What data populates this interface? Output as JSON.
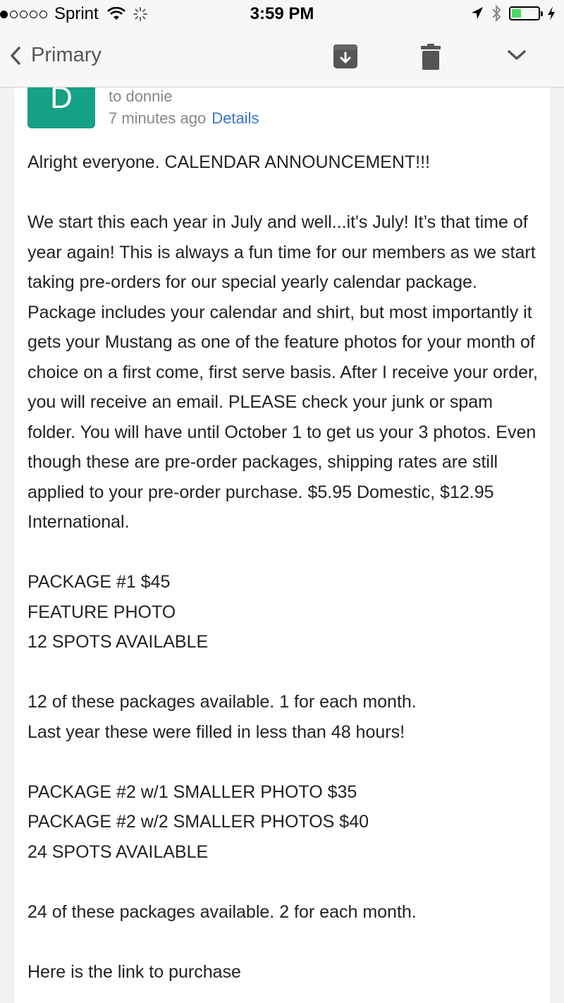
{
  "status": {
    "carrier": "Sprint",
    "time": "3:59 PM",
    "signal_dots_filled": 1,
    "signal_dots_total": 5,
    "battery_level": 0.35
  },
  "toolbar": {
    "back_label": "Primary"
  },
  "email": {
    "avatar_letter": "D",
    "to": "to donnie",
    "time_ago": "7 minutes ago",
    "details_link": "Details",
    "paragraphs": [
      [
        "Alright everyone. CALENDAR ANNOUNCEMENT!!!"
      ],
      [
        "We start this each year in July and well...it's July! It’s that time of year again! This is always a fun time for our members as we start taking pre-orders for our special yearly calendar package. Package includes your calendar and shirt, but most importantly it gets your Mustang as one of the feature photos for your month of choice on a first come, first serve basis. After I receive your order, you will receive an email. PLEASE check your junk or spam folder. You will have until October 1 to get us your 3 photos. Even though these are pre-order packages, shipping rates are still applied to your pre-order purchase. $5.95 Domestic, $12.95 International."
      ],
      [
        "PACKAGE #1 $45",
        "FEATURE PHOTO",
        "12 SPOTS AVAILABLE"
      ],
      [
        "12 of these packages available. 1 for each month.",
        "Last year these were filled in less than 48 hours!"
      ],
      [
        "PACKAGE #2 w/1 SMALLER PHOTO $35",
        "PACKAGE #2 w/2 SMALLER PHOTOS $40",
        "24 SPOTS AVAILABLE"
      ],
      [
        "24 of these packages available. 2 for each month."
      ],
      [
        "Here is the link to purchase"
      ]
    ]
  }
}
